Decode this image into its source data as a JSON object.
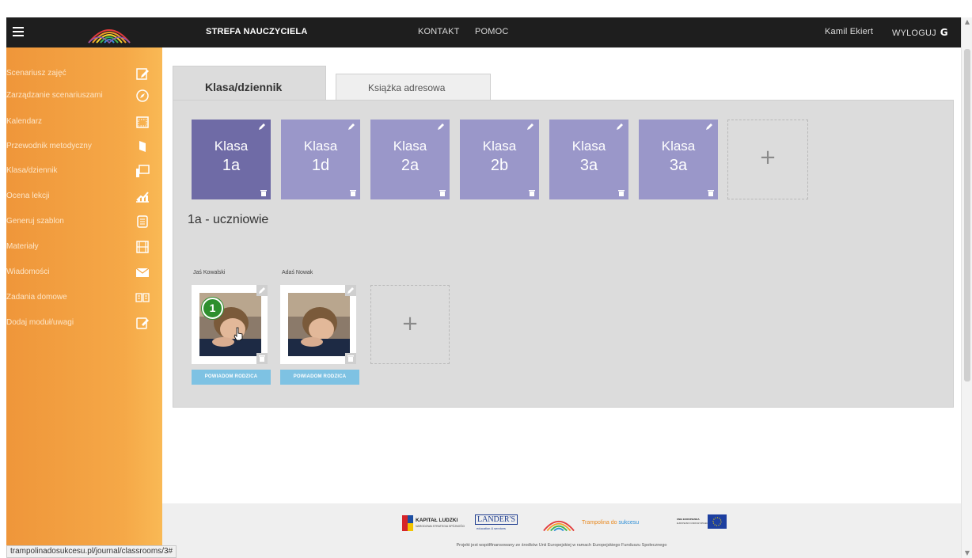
{
  "topbar": {
    "strefa": "STREFA NAUCZYCIELA",
    "kontakt": "KONTAKT",
    "pomoc": "POMOC",
    "user": "Kamil Ekiert",
    "logout": "WYLOGUJ"
  },
  "sidebar": {
    "items": [
      {
        "label": "Scenariusz zajęć",
        "icon": "edit-icon"
      },
      {
        "label": "Zarządzanie scenariuszami",
        "icon": "compass-icon"
      },
      {
        "label": "Kalendarz",
        "icon": "calendar-icon"
      },
      {
        "label": "Przewodnik metodyczny",
        "icon": "book-icon"
      },
      {
        "label": "Klasa/dziennik",
        "icon": "chalkboard-icon"
      },
      {
        "label": "Ocena lekcji",
        "icon": "chart-icon"
      },
      {
        "label": "Generuj szablon",
        "icon": "document-icon"
      },
      {
        "label": "Materiały",
        "icon": "film-icon"
      },
      {
        "label": "Wiadomości",
        "icon": "envelope-icon"
      },
      {
        "label": "Zadania domowe",
        "icon": "open-book-icon"
      },
      {
        "label": "Dodaj moduł/uwagi",
        "icon": "note-icon"
      }
    ]
  },
  "tabs": {
    "active": "Klasa/dziennik",
    "inactive": "Książka adresowa"
  },
  "classes": [
    {
      "word": "Klasa",
      "code": "1a",
      "selected": true
    },
    {
      "word": "Klasa",
      "code": "1d",
      "selected": false
    },
    {
      "word": "Klasa",
      "code": "2a",
      "selected": false
    },
    {
      "word": "Klasa",
      "code": "2b",
      "selected": false
    },
    {
      "word": "Klasa",
      "code": "3a",
      "selected": false
    },
    {
      "word": "Klasa",
      "code": "3a",
      "selected": false
    }
  ],
  "add_symbol": "+",
  "students_title": "1a - uczniowie",
  "students": [
    {
      "name": "Jaś Kowalski",
      "button": "POWIADOM RODZICA",
      "badge": "1"
    },
    {
      "name": "Adaś Nowak",
      "button": "POWIADOM RODZICA"
    }
  ],
  "footer": {
    "logos": {
      "kapital": "KAPITAŁ LUDZKI",
      "kapital_sub": "NARODOWA STRATEGIA SPÓJNOŚCI",
      "landers": "LANDER'S",
      "landers_sub": "education & services",
      "trampolina_a": "Trampolina do",
      "trampolina_b": "sukcesu",
      "ue": "UNIA EUROPEJSKA",
      "ue_sub": "EUROPEJSKI FUNDUSZ SPOŁECZNY"
    },
    "caption": "Projekt jest współfinansowany ze środków Unii Europejskiej w ramach Europejskiego Funduszu Społecznego"
  },
  "status_url": "trampolinadosukcesu.pl/journal/classrooms/3#",
  "colors": {
    "topbar": "#1e1e1e",
    "sidebar": "#f5a847",
    "tile": "#9a97c9",
    "tile_selected": "#6f6ba6",
    "notify": "#7ec2e3",
    "badge": "#2e8f2e"
  }
}
